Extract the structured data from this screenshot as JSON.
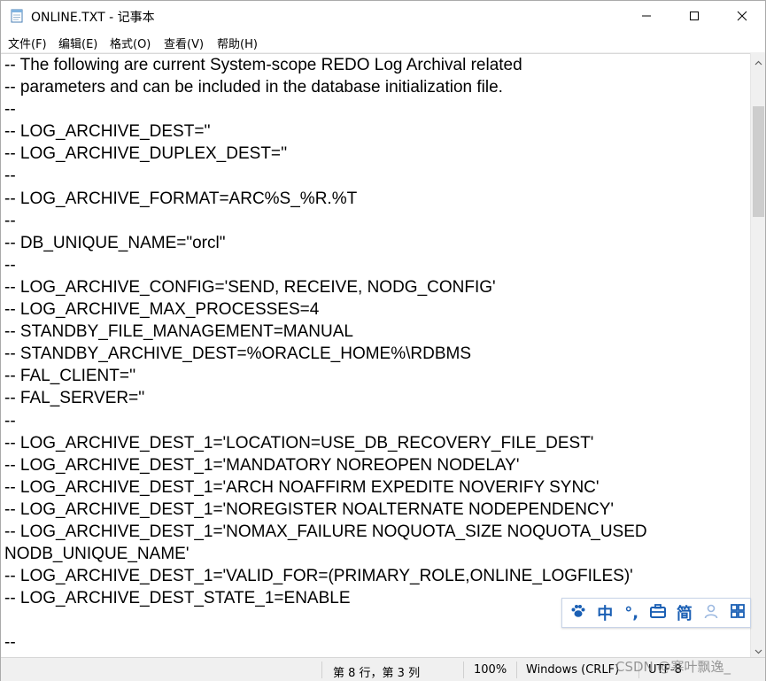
{
  "window": {
    "title": "ONLINE.TXT - 记事本",
    "app_icon": "notepad-icon",
    "controls": {
      "minimize": "minimize-icon",
      "maximize": "maximize-icon",
      "close": "close-icon"
    }
  },
  "menu": [
    {
      "label": "文件(F)"
    },
    {
      "label": "编辑(E)"
    },
    {
      "label": "格式(O)"
    },
    {
      "label": "查看(V)"
    },
    {
      "label": "帮助(H)"
    }
  ],
  "editor": {
    "lines": [
      "-- The following are current System-scope REDO Log Archival related",
      "-- parameters and can be included in the database initialization file.",
      "--",
      "-- LOG_ARCHIVE_DEST=''",
      "-- LOG_ARCHIVE_DUPLEX_DEST=''",
      "--",
      "-- LOG_ARCHIVE_FORMAT=ARC%S_%R.%T",
      "--",
      "-- DB_UNIQUE_NAME=\"orcl\"",
      "--",
      "-- LOG_ARCHIVE_CONFIG='SEND, RECEIVE, NODG_CONFIG'",
      "-- LOG_ARCHIVE_MAX_PROCESSES=4",
      "-- STANDBY_FILE_MANAGEMENT=MANUAL",
      "-- STANDBY_ARCHIVE_DEST=%ORACLE_HOME%\\RDBMS",
      "-- FAL_CLIENT=''",
      "-- FAL_SERVER=''",
      "--",
      "-- LOG_ARCHIVE_DEST_1='LOCATION=USE_DB_RECOVERY_FILE_DEST'",
      "-- LOG_ARCHIVE_DEST_1='MANDATORY NOREOPEN NODELAY'",
      "-- LOG_ARCHIVE_DEST_1='ARCH NOAFFIRM EXPEDITE NOVERIFY SYNC'",
      "-- LOG_ARCHIVE_DEST_1='NOREGISTER NOALTERNATE NODEPENDENCY'",
      "-- LOG_ARCHIVE_DEST_1='NOMAX_FAILURE NOQUOTA_SIZE NOQUOTA_USED",
      "NODB_UNIQUE_NAME'",
      "-- LOG_ARCHIVE_DEST_1='VALID_FOR=(PRIMARY_ROLE,ONLINE_LOGFILES)'",
      "-- LOG_ARCHIVE_DEST_STATE_1=ENABLE",
      "",
      "--"
    ]
  },
  "statusbar": {
    "position": "第 8 行，第 3 列",
    "zoom": "100%",
    "line_ending": "Windows (CRLF)",
    "encoding": "UTF-8"
  },
  "ime": {
    "items": [
      {
        "icon": "paw-icon"
      },
      {
        "label": "中"
      },
      {
        "label": "°,"
      },
      {
        "icon": "toolbox-icon"
      },
      {
        "label": "简"
      },
      {
        "icon": "user-icon"
      },
      {
        "icon": "grid-icon"
      }
    ]
  },
  "watermark": "CSDN @寒叶飘逸_",
  "colors": {
    "accent": "#1a5fb4",
    "statusbar_bg": "#f0f0f0"
  }
}
